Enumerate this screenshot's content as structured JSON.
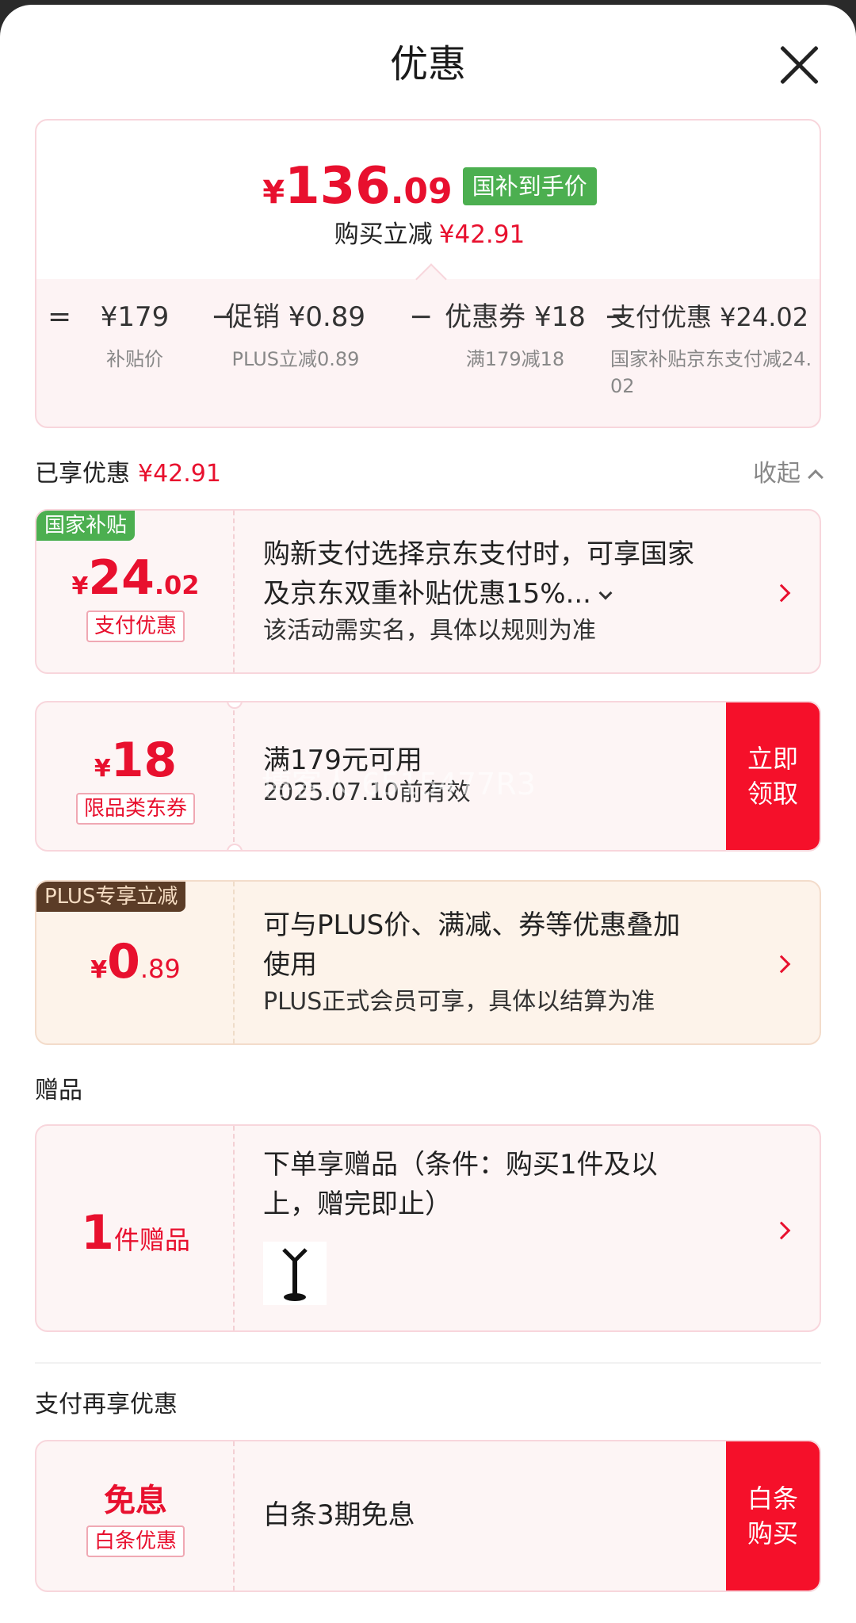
{
  "header": {
    "title": "优惠"
  },
  "summary": {
    "currency": "¥",
    "price_int": "136",
    "price_dec": ".09",
    "badge": "国补到手价",
    "sub_label": "购买立减",
    "sub_amount": "¥42.91",
    "formula": {
      "eq": "=",
      "minus": "−",
      "items": [
        {
          "value": "¥179",
          "label": "补贴价"
        },
        {
          "value": "促销 ¥0.89",
          "label": "PLUS立减0.89"
        },
        {
          "value": "优惠券 ¥18",
          "label": "满179减18"
        },
        {
          "value": "支付优惠 ¥24.02",
          "label": "国家补贴京东支付减24.02"
        }
      ]
    }
  },
  "enjoyed": {
    "label": "已享优惠",
    "amount": "¥42.91",
    "collapse": "收起"
  },
  "card_gov": {
    "tag": "国家补贴",
    "currency": "¥",
    "amount_int": "24",
    "amount_dec": ".02",
    "type": "支付优惠",
    "desc_line1": "购新支付选择京东支付时，可享国家",
    "desc_line2": "及京东双重补贴优惠15%...",
    "note": "该活动需实名，具体以规则为准",
    "colors": {
      "tag_bg": "#4caf50"
    }
  },
  "card_coupon": {
    "currency": "¥",
    "amount_int": "18",
    "type": "限品类东券",
    "condition": "满179元可用",
    "validity": "2025.07.10前有效",
    "button": "立即\n领取",
    "button_line1": "立即",
    "button_line2": "领取",
    "watermark": "博客人 6515477R3"
  },
  "card_plus": {
    "tag": "PLUS专享立减",
    "currency": "¥",
    "amount_int": "0",
    "amount_dec": ".89",
    "desc_line1": "可与PLUS价、满减、券等优惠叠加",
    "desc_line2": "使用",
    "note": "PLUS正式会员可享，具体以结算为准",
    "colors": {
      "tag_bg": "#5b3c27"
    }
  },
  "gifts": {
    "section": "赠品",
    "count": "1",
    "unit": "件赠品",
    "desc_line1": "下单享赠品（条件：购买1件及以",
    "desc_line2": "上，赠完即止）"
  },
  "pay_more": {
    "section": "支付再享优惠",
    "title": "免息",
    "type": "白条优惠",
    "desc": "白条3期免息",
    "button_line1": "白条",
    "button_line2": "购买"
  },
  "colors": {
    "accent": "#e8102e",
    "button": "#f5102a",
    "card_bg": "#fdf5f5"
  }
}
